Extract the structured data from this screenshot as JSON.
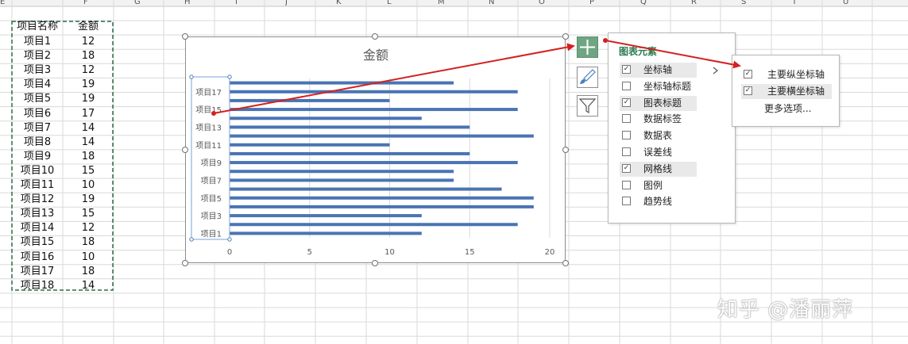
{
  "sheet": {
    "column_letters": [
      "E",
      "F",
      "G",
      "H",
      "I",
      "J",
      "K",
      "L",
      "M",
      "N",
      "O",
      "P",
      "Q",
      "R",
      "S",
      "T",
      "U"
    ],
    "table_headers": [
      "项目名称",
      "金额"
    ],
    "rows": [
      [
        "项目1",
        "12"
      ],
      [
        "项目2",
        "18"
      ],
      [
        "项目3",
        "12"
      ],
      [
        "项目4",
        "19"
      ],
      [
        "项目5",
        "19"
      ],
      [
        "项目6",
        "17"
      ],
      [
        "项目7",
        "14"
      ],
      [
        "项目8",
        "14"
      ],
      [
        "项目9",
        "18"
      ],
      [
        "项目10",
        "15"
      ],
      [
        "项目11",
        "10"
      ],
      [
        "项目12",
        "19"
      ],
      [
        "项目13",
        "15"
      ],
      [
        "项目14",
        "12"
      ],
      [
        "项目15",
        "18"
      ],
      [
        "项目16",
        "10"
      ],
      [
        "项目17",
        "18"
      ],
      [
        "项目18",
        "14"
      ]
    ]
  },
  "chart_data": {
    "type": "bar",
    "orientation": "horizontal",
    "title": "金额",
    "categories": [
      "项目1",
      "项目2",
      "项目3",
      "项目4",
      "项目5",
      "项目6",
      "项目7",
      "项目8",
      "项目9",
      "项目10",
      "项目11",
      "项目12",
      "项目13",
      "项目14",
      "项目15",
      "项目16",
      "项目17",
      "项目18"
    ],
    "values": [
      12,
      18,
      12,
      19,
      19,
      17,
      14,
      14,
      18,
      15,
      10,
      19,
      15,
      12,
      18,
      10,
      18,
      14
    ],
    "tick_labels_y": [
      "项目1",
      "项目3",
      "项目5",
      "项目7",
      "项目9",
      "项目11",
      "项目13",
      "项目15",
      "项目17"
    ],
    "xlim": [
      0,
      20
    ],
    "x_ticks": [
      0,
      5,
      10,
      15,
      20
    ],
    "grid": "vertical",
    "bar_color": "#4a74b3"
  },
  "chart_tools": {
    "elements_icon": "plus-icon",
    "styles_icon": "brush-icon",
    "filter_icon": "funnel-icon",
    "accent": "#6fa582"
  },
  "flyout": {
    "title": "图表元素",
    "items": [
      {
        "label": "坐标轴",
        "checked": true,
        "highlight": true,
        "has_submenu": true
      },
      {
        "label": "坐标轴标题",
        "checked": false,
        "highlight": false
      },
      {
        "label": "图表标题",
        "checked": true,
        "highlight": true
      },
      {
        "label": "数据标签",
        "checked": false,
        "highlight": false
      },
      {
        "label": "数据表",
        "checked": false,
        "highlight": false
      },
      {
        "label": "误差线",
        "checked": false,
        "highlight": false
      },
      {
        "label": "网格线",
        "checked": true,
        "highlight": true
      },
      {
        "label": "图例",
        "checked": false,
        "highlight": false
      },
      {
        "label": "趋势线",
        "checked": false,
        "highlight": false
      }
    ]
  },
  "submenu": {
    "items": [
      {
        "label": "主要纵坐标轴",
        "checked": true
      },
      {
        "label": "主要横坐标轴",
        "checked": true
      }
    ],
    "more_options": "更多选项..."
  },
  "watermark": "知乎 @潘丽萍",
  "annotation_color": "#d42020"
}
